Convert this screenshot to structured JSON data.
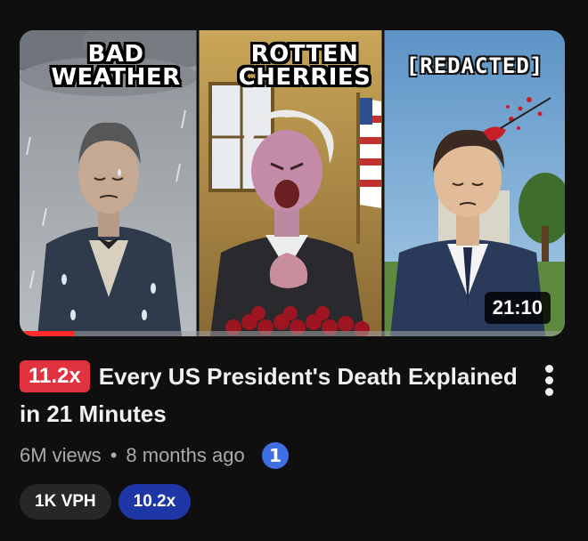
{
  "thumbnail": {
    "labels": [
      "BAD\nWEATHER",
      "ROTTEN\nCHERRIES",
      "[REDACTED]"
    ],
    "duration": "21:10",
    "watched_fraction": 0.1
  },
  "video": {
    "outlier_badge": "11.2x",
    "title": "Every US President's Death Explained in 21 Minutes",
    "views": "6M views",
    "separator": "•",
    "age": "8 months ago",
    "info_badge": "1"
  },
  "chips": {
    "vph": "1K VPH",
    "ratio": "10.2x"
  },
  "icons": {
    "menu": "more-vert-icon",
    "info": "info-badge-icon"
  },
  "colors": {
    "background": "#0f0f0f",
    "outlier_badge": "#e0333f",
    "ratio_chip": "#1f37a6",
    "progress": "#ff2b2b",
    "info_icon": "#3f6ee6"
  }
}
